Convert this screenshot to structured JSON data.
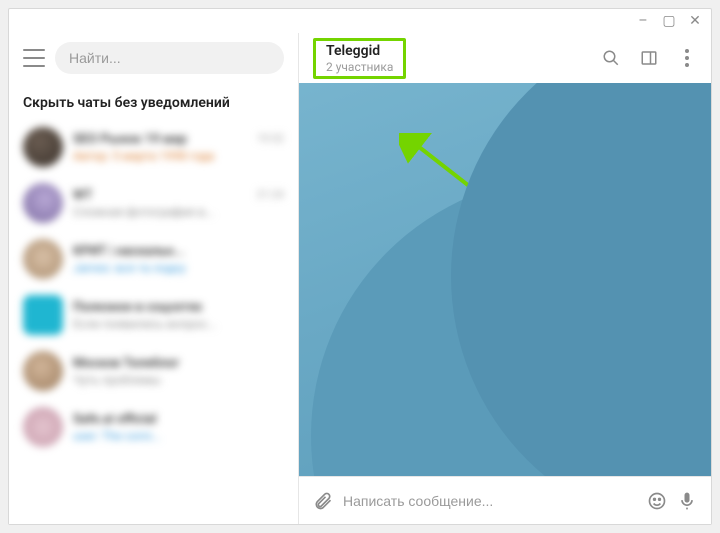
{
  "window_controls": {
    "min": "–",
    "max": "▢",
    "close": "✕"
  },
  "search": {
    "placeholder": "Найти..."
  },
  "pin_header": "Скрыть чаты без уведомлений",
  "chat_header": {
    "title": "Teleggid",
    "subtitle": "2 участника"
  },
  "composer": {
    "placeholder": "Написать сообщение..."
  },
  "chats": [
    {
      "ava": "c0",
      "name": "SEO Рынок 19 мар",
      "time": "19:32",
      "preview": "Автор: 5 марта 1998 года",
      "accent": "orange"
    },
    {
      "ava": "c1",
      "name": "WT",
      "time": "21:24",
      "preview": "Сложная фотография в..."
    },
    {
      "ava": "c2",
      "name": "КРИТ | наскальн...",
      "time": "",
      "preview": "James: вся та лодку",
      "accent": "blue"
    },
    {
      "ava": "c3",
      "name": "Полезное в соцсетях",
      "time": "",
      "preview": "Если появились вопрос..."
    },
    {
      "ava": "c4",
      "name": "Москов Телеблог",
      "time": "",
      "preview": "Чуть проблемы"
    },
    {
      "ava": "c5",
      "name": "Safe.ai official",
      "time": "",
      "preview": "user: The comi...",
      "accent": "blue"
    }
  ]
}
